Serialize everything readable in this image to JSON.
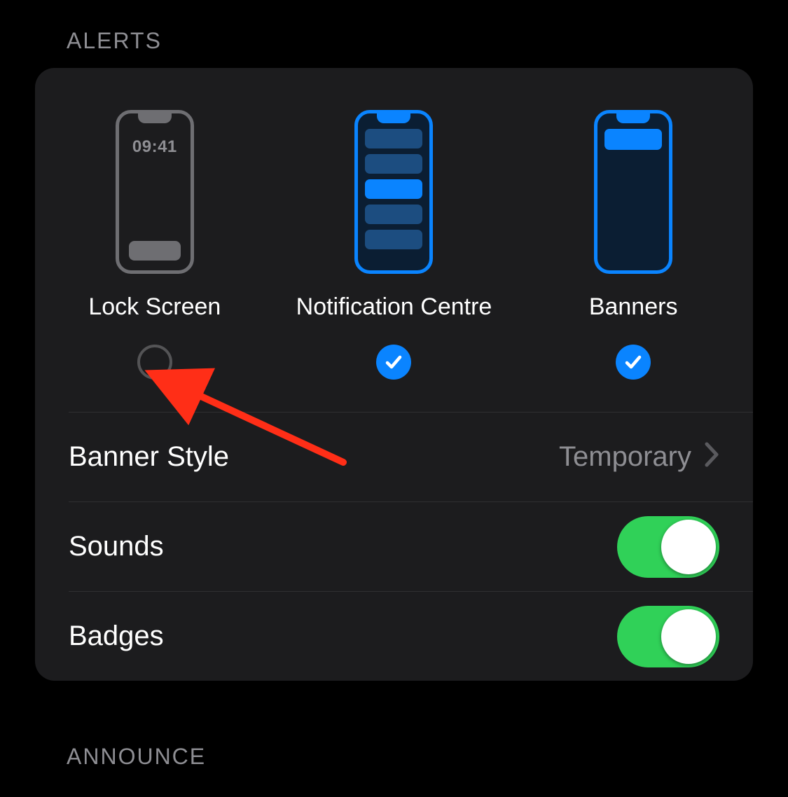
{
  "sections": {
    "alerts_header": "ALERTS",
    "announce_header": "ANNOUNCE"
  },
  "alertOptions": [
    {
      "label": "Lock Screen",
      "checked": false,
      "time_text": "09:41"
    },
    {
      "label": "Notification Centre",
      "checked": true
    },
    {
      "label": "Banners",
      "checked": true
    }
  ],
  "rows": {
    "bannerStyle": {
      "label": "Banner Style",
      "value": "Temporary"
    },
    "sounds": {
      "label": "Sounds",
      "on": true
    },
    "badges": {
      "label": "Badges",
      "on": true
    }
  },
  "colors": {
    "accent": "#0a84ff",
    "toggleOn": "#30d158",
    "cardBg": "#1c1c1e",
    "annotation": "#ff2e17"
  }
}
